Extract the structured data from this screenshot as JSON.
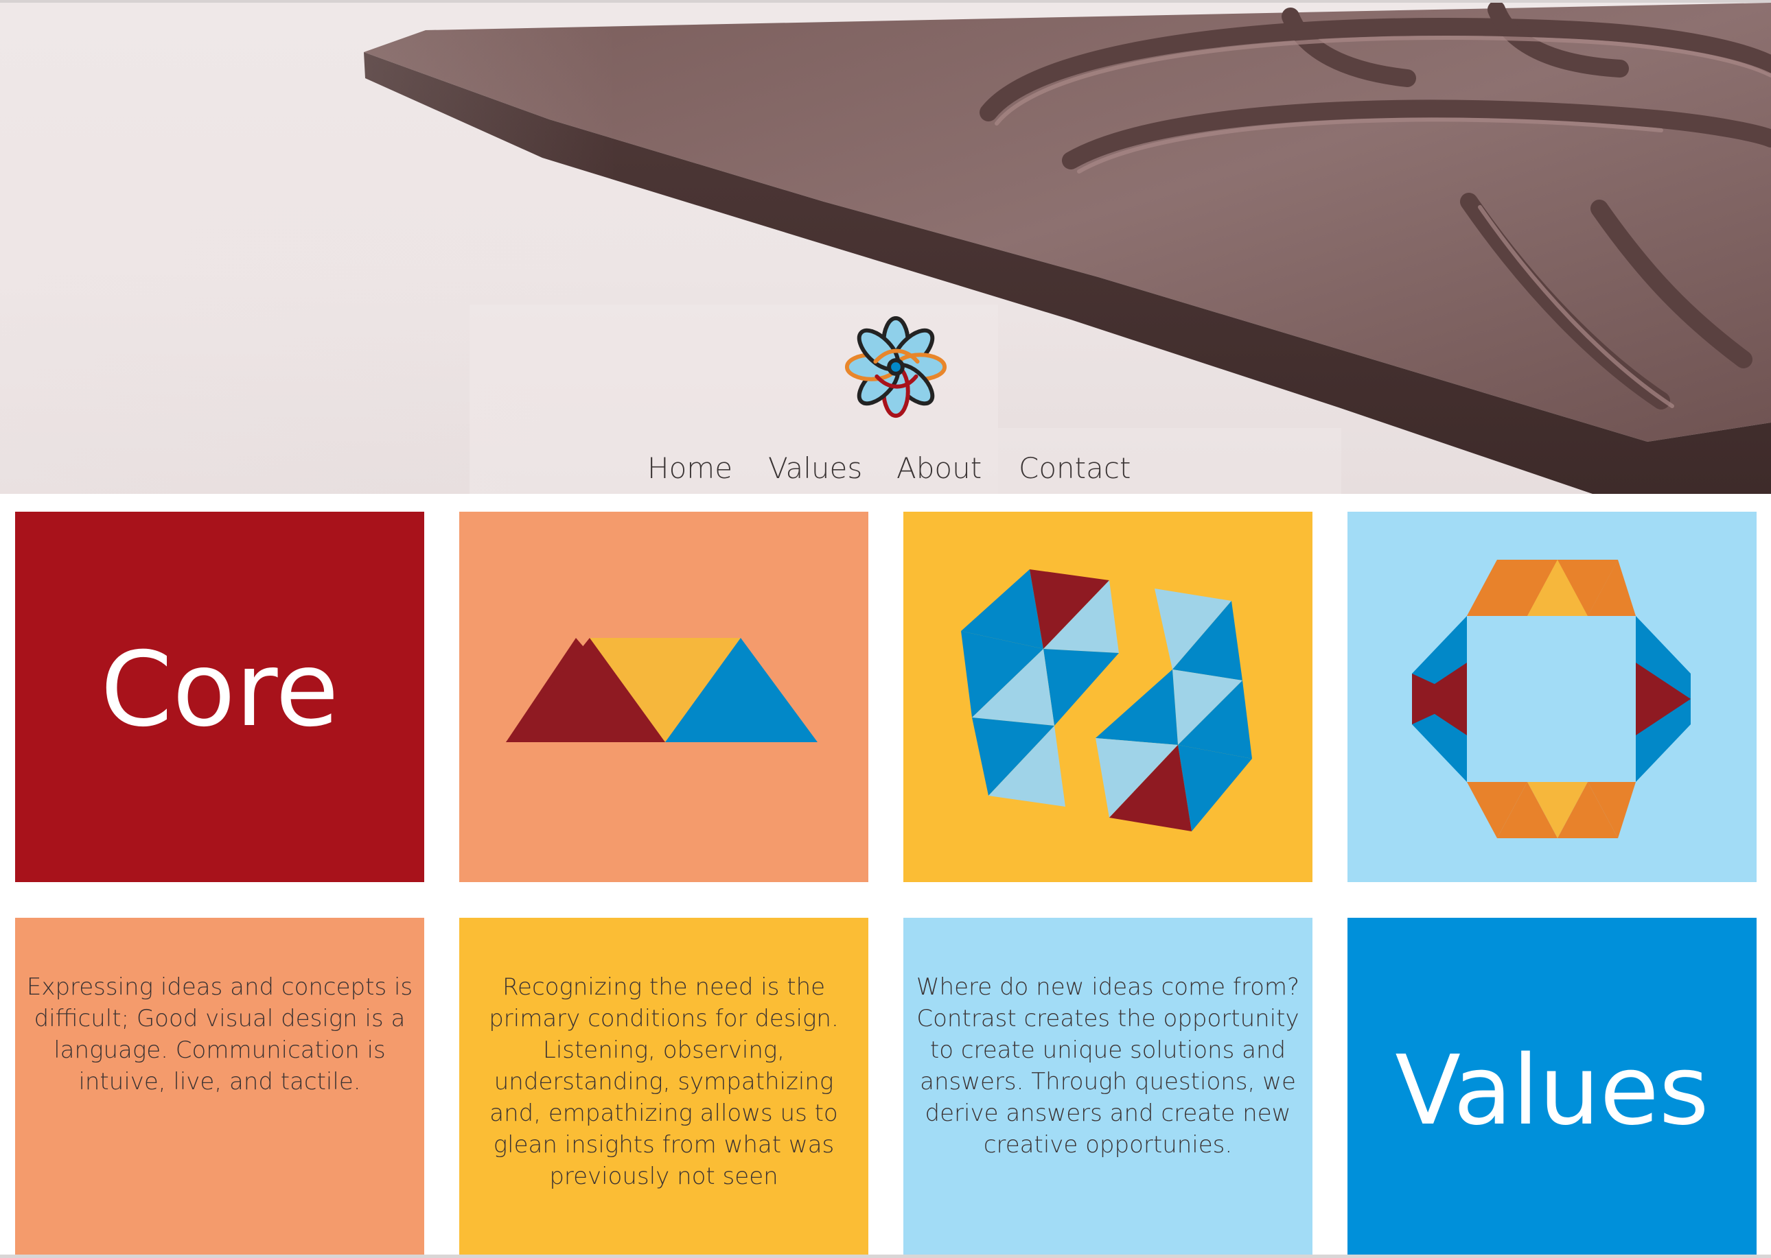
{
  "header": {
    "logo_name": "flower-knot-logo",
    "nav": [
      {
        "label": "Home"
      },
      {
        "label": "Values"
      },
      {
        "label": "About"
      },
      {
        "label": "Contact"
      }
    ]
  },
  "tiles": {
    "row1": [
      {
        "kind": "word",
        "text": "Core",
        "color": "#a8121b"
      },
      {
        "kind": "graphic",
        "icon": "triangle-trio-graphic",
        "color": "#f49b6c"
      },
      {
        "kind": "graphic",
        "icon": "interlocking-triangles-graphic",
        "color": "#fbbd35"
      },
      {
        "kind": "graphic",
        "icon": "octagon-frame-graphic",
        "color": "#a2dcf6"
      }
    ],
    "row2": [
      {
        "kind": "text",
        "text": "Expressing ideas and concepts is difficult; Good visual design is a language. Communication is intuive, live, and tactile.",
        "color": "#f49b6c"
      },
      {
        "kind": "text",
        "text": "Recognizing the need is the primary conditions for design. Listening, observing, understanding, sympathizing and, empathizing allows us to glean insights from what was previously not seen",
        "color": "#fbbd35"
      },
      {
        "kind": "text",
        "text": "Where do new ideas come from? Contrast creates the opportunity to create unique solutions and answers. Through questions, we derive answers and create new creative opportunies.",
        "color": "#a2dcf6"
      },
      {
        "kind": "word",
        "text": "Values",
        "color": "#0090da"
      }
    ]
  },
  "palette": {
    "crimson": "#a8121b",
    "deep_red": "#8f1a22",
    "salmon": "#f49b6c",
    "gold": "#fbbd35",
    "amber": "#f6b73c",
    "orange": "#e8822b",
    "sky": "#a2dcf6",
    "light_blue": "#9fd3e8",
    "blue": "#0288c8",
    "bright_blue": "#0090da"
  }
}
